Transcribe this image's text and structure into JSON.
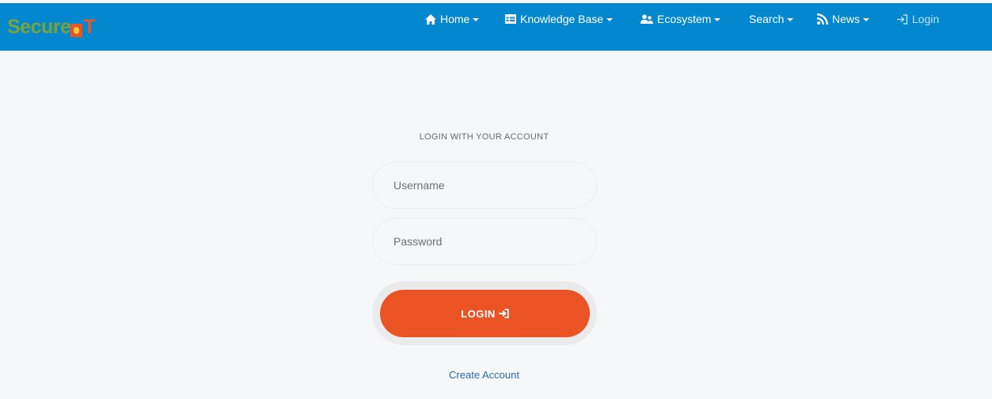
{
  "brand": {
    "logo_part1": "Secure",
    "logo_part2": "T"
  },
  "nav": {
    "home": "Home",
    "knowledge_base": "Knowledge Base",
    "ecosystem": "Ecosystem",
    "search": "Search",
    "news": "News",
    "login": "Login"
  },
  "form": {
    "heading": "LOGIN WITH YOUR ACCOUNT",
    "username_placeholder": "Username",
    "password_placeholder": "Password",
    "submit_label": "LOGIN",
    "create_account": "Create Account"
  },
  "colors": {
    "topbar": "#0387cf",
    "accent": "#ea5425",
    "link": "#2b6ca8",
    "background": "#f6f7f9"
  },
  "icons": {
    "home": "home-icon",
    "knowledge_base": "table-icon",
    "ecosystem": "users-icon",
    "news": "rss-icon",
    "login": "sign-in-icon",
    "submit": "sign-in-icon"
  }
}
